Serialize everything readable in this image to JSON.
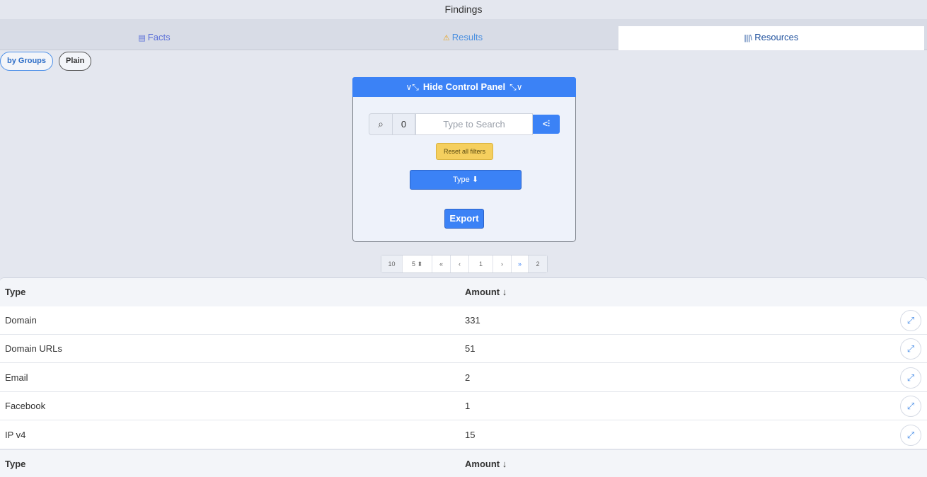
{
  "window": {
    "title": "Findings"
  },
  "tabs": [
    {
      "label": "Facts",
      "icon": "list-icon"
    },
    {
      "label": "Results",
      "icon": "warning-icon"
    },
    {
      "label": "Resources",
      "icon": "library-icon"
    }
  ],
  "view_modes": {
    "groups_label": "by Groups",
    "plain_label": "Plain"
  },
  "control_panel": {
    "toggle_label": "Hide Control Panel",
    "search_count": "0",
    "search_placeholder": "Type to Search",
    "filter_button_label": "<",
    "reset_label": "Reset all filters",
    "type_button_label": "Type ⬇",
    "export_label": "Export"
  },
  "pagination": {
    "page_size_option": "10",
    "page_size_selected": "5",
    "first": "«",
    "prev": "‹",
    "current_page": "1",
    "next": "›",
    "last": "»",
    "total_pages": "2"
  },
  "table": {
    "headers": {
      "type": "Type",
      "amount": "Amount ↓"
    },
    "rows": [
      {
        "type": "Domain",
        "amount": "331"
      },
      {
        "type": "Domain URLs",
        "amount": "51"
      },
      {
        "type": "Email",
        "amount": "2"
      },
      {
        "type": "Facebook",
        "amount": "1"
      },
      {
        "type": "IP v4",
        "amount": "15"
      }
    ],
    "footer": {
      "type": "Type",
      "amount": "Amount ↓"
    }
  },
  "colors": {
    "accent": "#3b82f6",
    "warning": "#f5cf5e",
    "background": "#e4e7ef"
  }
}
